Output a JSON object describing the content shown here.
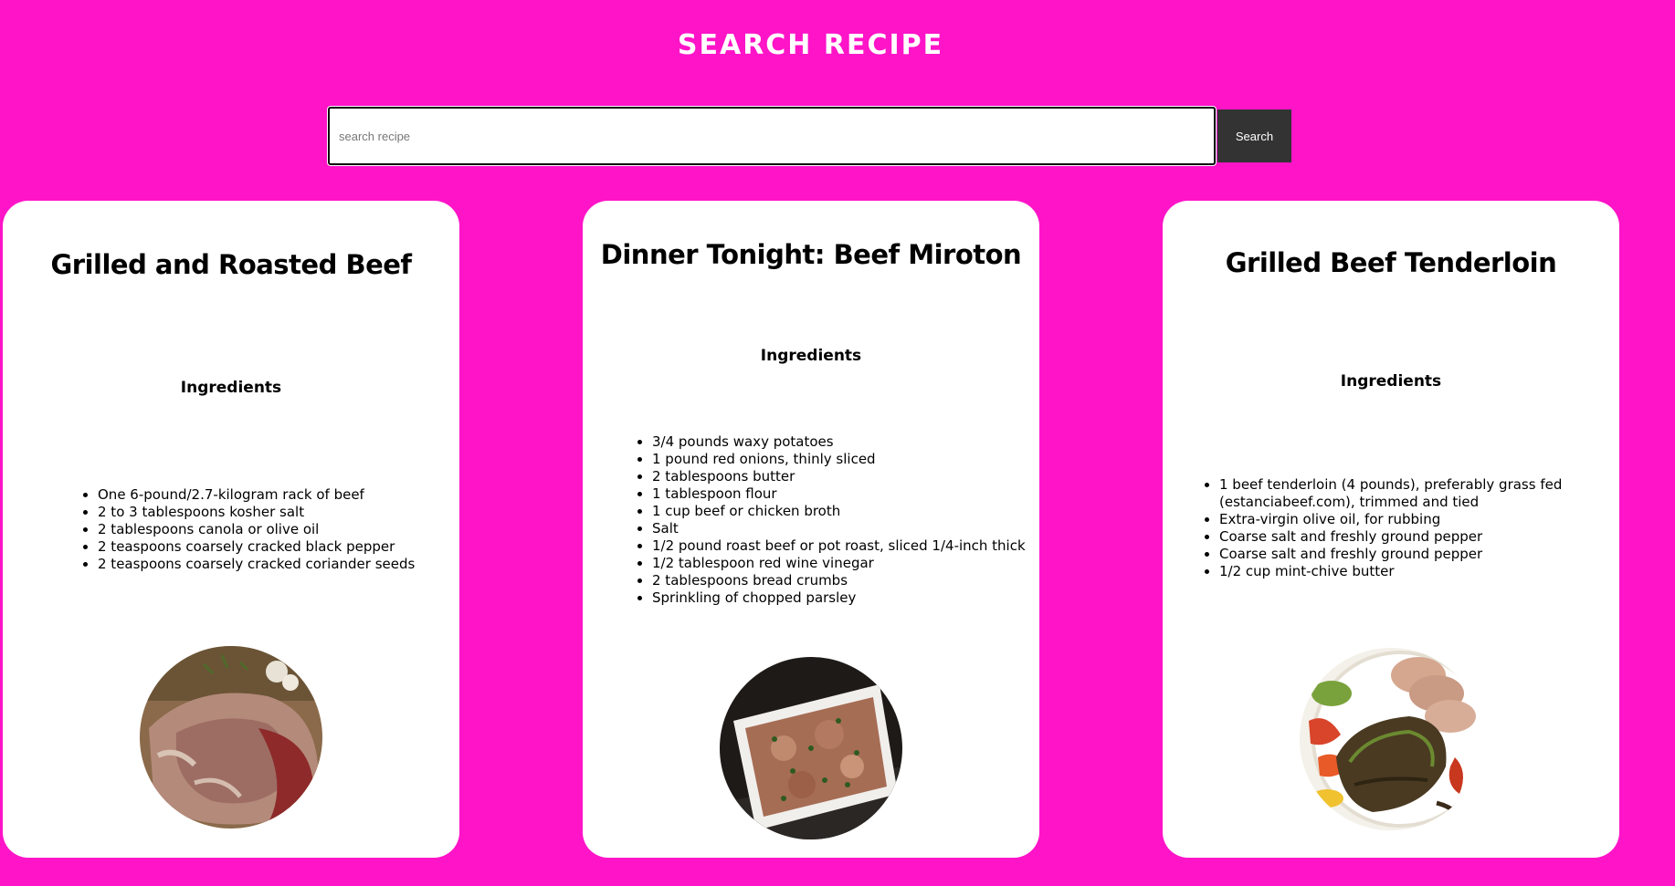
{
  "header": {
    "title": "SEARCH RECIPE"
  },
  "search": {
    "placeholder": "search recipe",
    "value": "",
    "button_label": "Search"
  },
  "ingredients_label": "Ingredients",
  "recipes": [
    {
      "title": "Grilled and Roasted Beef",
      "ingredients": [
        "One 6-pound/2.7-kilogram rack of beef",
        "2 to 3 tablespoons kosher salt",
        "2 tablespoons canola or olive oil",
        "2 teaspoons coarsely cracked black pepper",
        "2 teaspoons coarsely cracked coriander seeds"
      ],
      "image_icon": "roast-beef-photo"
    },
    {
      "title": "Dinner Tonight: Beef Miroton",
      "ingredients": [
        "3/4 pounds waxy potatoes",
        "1 pound red onions, thinly sliced",
        "2 tablespoons butter",
        "1 tablespoon flour",
        "1 cup beef or chicken broth",
        "Salt",
        "1/2 pound roast beef or pot roast, sliced 1/4-inch thick",
        "1/2 tablespoon red wine vinegar",
        "2 tablespoons bread crumbs",
        "Sprinkling of chopped parsley"
      ],
      "image_icon": "beef-miroton-photo"
    },
    {
      "title": "Grilled Beef Tenderloin",
      "ingredients": [
        "1 beef tenderloin (4 pounds), preferably grass fed (estanciabeef.com), trimmed and tied",
        "Extra-virgin olive oil, for rubbing",
        "Coarse salt and freshly ground pepper",
        "Coarse salt and freshly ground pepper",
        "1/2 cup mint-chive butter"
      ],
      "image_icon": "beef-tenderloin-photo"
    }
  ],
  "colors": {
    "background": "#ff14c8",
    "card": "#ffffff",
    "button": "#333333"
  }
}
